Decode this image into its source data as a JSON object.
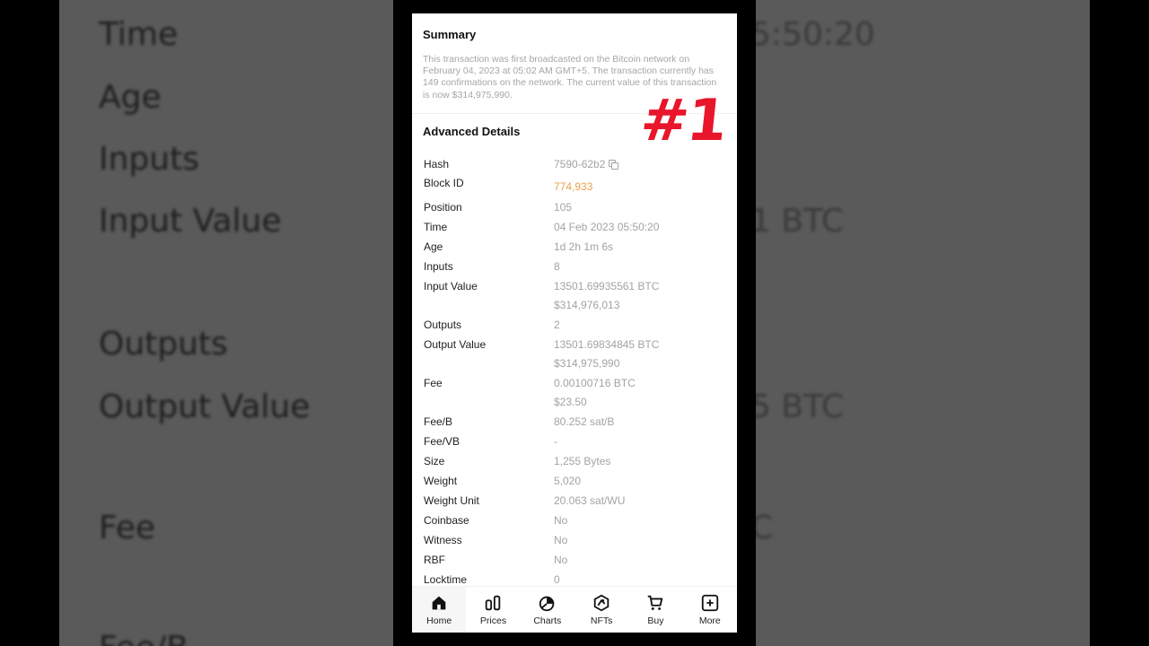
{
  "backdrop": {
    "left_labels": [
      "Time",
      "Age",
      "Inputs",
      "Input Value",
      "Outputs",
      "Output Value",
      "Fee",
      "Fee/B"
    ],
    "right_fragments": [
      "5:50:20",
      "1 BTC",
      "5 BTC",
      "C"
    ]
  },
  "summary": {
    "title": "Summary",
    "text": "This transaction was first broadcasted on the Bitcoin network on February 04, 2023 at 05:02 AM GMT+5. The transaction currently has 149 confirmations on the network. The current value of this transaction is now $314,975,990."
  },
  "badge": "#1",
  "advanced": {
    "title": "Advanced Details",
    "rows": [
      {
        "key": "Hash",
        "value": "7590-62b2"
      },
      {
        "key": "Block ID",
        "value": "774,933"
      },
      {
        "key": "Position",
        "value": "105"
      },
      {
        "key": "Time",
        "value": "04 Feb 2023 05:50:20"
      },
      {
        "key": "Age",
        "value": "1d 2h 1m 6s"
      },
      {
        "key": "Inputs",
        "value": "8"
      },
      {
        "key": "Input Value",
        "value": "13501.69935561 BTC",
        "value2": "$314,976,013"
      },
      {
        "key": "Outputs",
        "value": "2"
      },
      {
        "key": "Output Value",
        "value": "13501.69834845 BTC",
        "value2": "$314,975,990"
      },
      {
        "key": "Fee",
        "value": "0.00100716 BTC",
        "value2": "$23.50"
      },
      {
        "key": "Fee/B",
        "value": "80.252 sat/B"
      },
      {
        "key": "Fee/VB",
        "value": "-"
      },
      {
        "key": "Size",
        "value": "1,255 Bytes"
      },
      {
        "key": "Weight",
        "value": "5,020"
      },
      {
        "key": "Weight Unit",
        "value": "20.063 sat/WU"
      },
      {
        "key": "Coinbase",
        "value": "No"
      },
      {
        "key": "Witness",
        "value": "No"
      },
      {
        "key": "RBF",
        "value": "No"
      },
      {
        "key": "Locktime",
        "value": "0"
      }
    ]
  },
  "tabs": [
    {
      "label": "Home",
      "icon": "home-icon"
    },
    {
      "label": "Prices",
      "icon": "bar-chart-icon"
    },
    {
      "label": "Charts",
      "icon": "pie-chart-icon"
    },
    {
      "label": "NFTs",
      "icon": "nft-icon"
    },
    {
      "label": "Buy",
      "icon": "cart-icon"
    },
    {
      "label": "More",
      "icon": "plus-square-icon"
    }
  ],
  "colors": {
    "accent_orange": "#e7a14b",
    "badge_red": "#e8152b"
  }
}
